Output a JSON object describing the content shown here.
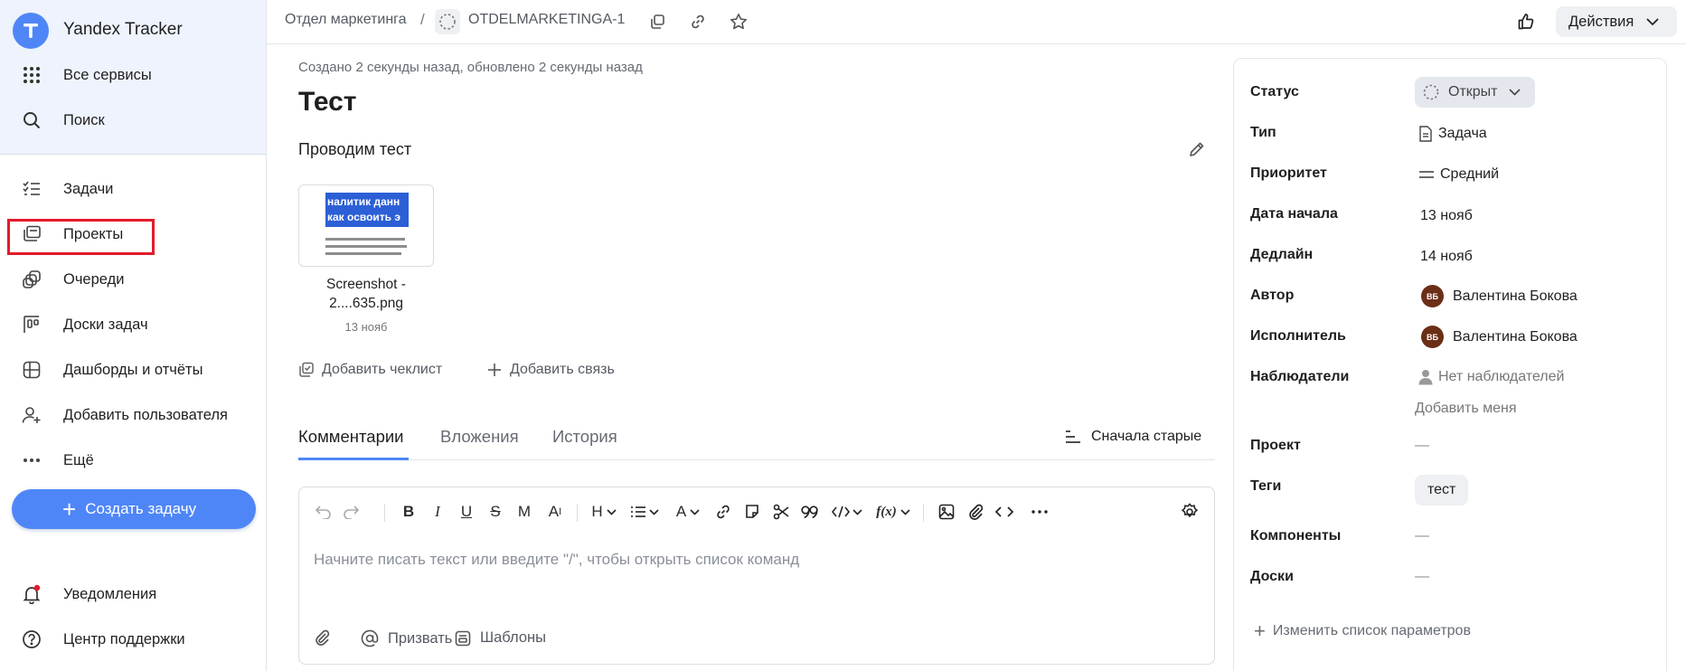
{
  "sidebar": {
    "brand": "Yandex Tracker",
    "top_items": [
      {
        "label": "Все сервисы",
        "icon": "grid-icon"
      },
      {
        "label": "Поиск",
        "icon": "search-icon"
      }
    ],
    "items": [
      {
        "label": "Задачи",
        "icon": "tasks-icon"
      },
      {
        "label": "Проекты",
        "icon": "projects-icon",
        "highlighted": true
      },
      {
        "label": "Очереди",
        "icon": "queues-icon"
      },
      {
        "label": "Доски задач",
        "icon": "boards-icon"
      },
      {
        "label": "Дашборды и отчёты",
        "icon": "dashboards-icon"
      },
      {
        "label": "Добавить пользователя",
        "icon": "add-user-icon"
      },
      {
        "label": "Ещё",
        "icon": "more-icon"
      }
    ],
    "create_button": "Создать задачу",
    "bottom_items": [
      {
        "label": "Уведомления",
        "icon": "bell-icon"
      },
      {
        "label": "Центр поддержки",
        "icon": "help-icon"
      }
    ]
  },
  "topbar": {
    "breadcrumb_queue": "Отдел маркетинга",
    "separator": "/",
    "issue_key": "OTDELMARKETINGA-1",
    "actions_label": "Действия"
  },
  "issue": {
    "meta": "Создано 2 секунды назад, обновлено 2 секунды назад",
    "title": "Тест",
    "description": "Проводим тест",
    "attachment": {
      "name_line1": "Screenshot -",
      "name_line2": "2....635.png",
      "date": "13 нояб",
      "preview_line1": "налитик данн",
      "preview_line2": "как освоить э"
    },
    "add_checklist": "Добавить чеклист",
    "add_link": "Добавить связь"
  },
  "tabs": {
    "items": [
      "Комментарии",
      "Вложения",
      "История"
    ],
    "active": 0,
    "sort_label": "Сначала старые"
  },
  "editor": {
    "placeholder": "Начните писать текст или введите \"/\", чтобы открыть список команд",
    "mention": "Призвать",
    "templates": "Шаблоны"
  },
  "fields": {
    "status_label": "Статус",
    "status_value": "Открыт",
    "type_label": "Тип",
    "type_value": "Задача",
    "priority_label": "Приоритет",
    "priority_value": "Средний",
    "start_label": "Дата начала",
    "start_value": "13 нояб",
    "deadline_label": "Дедлайн",
    "deadline_value": "14 нояб",
    "author_label": "Автор",
    "author_value": "Валентина Бокова",
    "author_initials": "ВБ",
    "assignee_label": "Исполнитель",
    "assignee_value": "Валентина Бокова",
    "assignee_initials": "ВБ",
    "watchers_label": "Наблюдатели",
    "watchers_value": "Нет наблюдателей",
    "add_me": "Добавить меня",
    "project_label": "Проект",
    "project_value": "—",
    "tags_label": "Теги",
    "tags_value": "тест",
    "components_label": "Компоненты",
    "components_value": "—",
    "boards_label": "Доски",
    "boards_value": "—",
    "edit_params": "Изменить список параметров"
  },
  "colors": {
    "accent": "#4f86f7",
    "highlight_box": "#e31b2b",
    "sidebar_top_bg": "#eef3fd",
    "avatar": "#6b2f17"
  }
}
